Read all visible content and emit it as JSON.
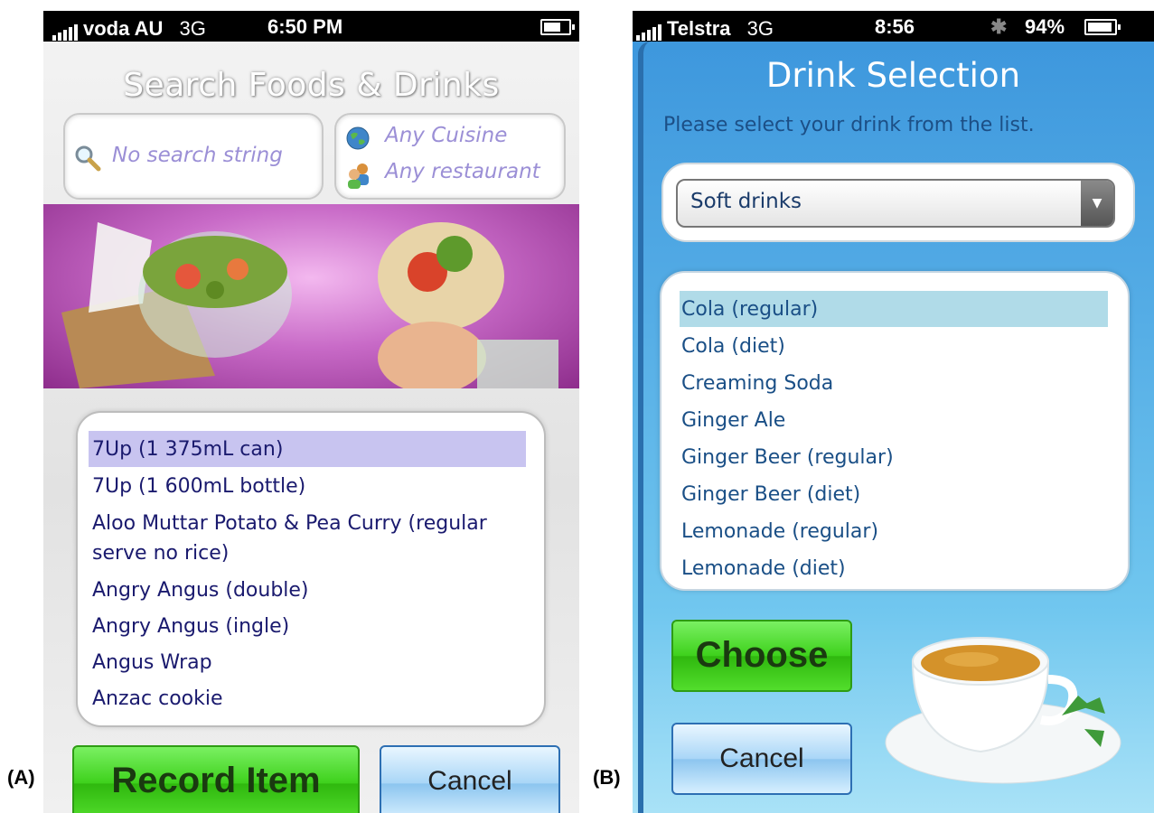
{
  "labels": {
    "panel_a": "(A)",
    "panel_b": "(B)"
  },
  "phone_a": {
    "status": {
      "carrier": "voda AU",
      "network": "3G",
      "time": "6:50 PM",
      "battery_level": 0.7
    },
    "title": "Search Foods & Drinks",
    "search_placeholder": "No search string",
    "cuisine": "Any Cuisine",
    "restaurant": "Any restaurant",
    "list_items": [
      "7Up (1 375mL can)",
      "7Up (1 600mL bottle)",
      "Aloo Muttar Potato & Pea Curry (regular",
      "serve no rice)",
      "Angry Angus (double)",
      "Angry Angus (ingle)",
      "Angus Wrap",
      "Anzac cookie"
    ],
    "record_button": "Record Item",
    "cancel_button": "Cancel",
    "colors": {
      "selected_row": "#c8c4f0",
      "item_text": "#1a1a6e"
    }
  },
  "phone_b": {
    "status": {
      "carrier": "Telstra",
      "network": "3G",
      "time": "8:56",
      "battery": "94%",
      "battery_level": 0.94
    },
    "title": "Drink Selection",
    "instruction": "Please select your drink from the list.",
    "dropdown_value": "Soft drinks",
    "list_items": [
      "Cola (regular)",
      "Cola (diet)",
      "Creaming Soda",
      "Ginger Ale",
      "Ginger Beer (regular)",
      "Ginger Beer (diet)",
      "Lemonade (regular)",
      "Lemonade (diet)"
    ],
    "choose_button": "Choose",
    "cancel_button": "Cancel",
    "colors": {
      "selected_row": "#b0dbe8",
      "item_text": "#1a4f86"
    }
  }
}
